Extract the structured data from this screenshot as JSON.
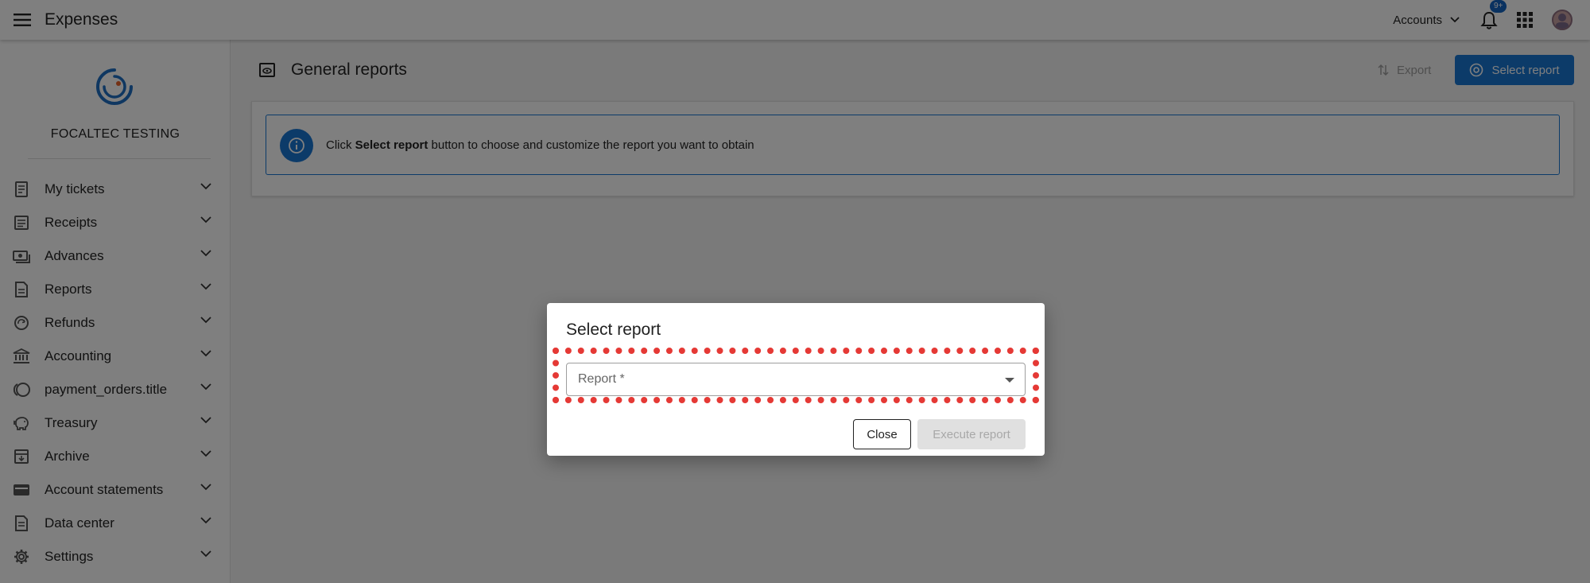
{
  "app": {
    "title": "Expenses"
  },
  "topbar": {
    "accounts_label": "Accounts",
    "notification_badge": "9+"
  },
  "sidebar": {
    "org_name": "FOCALTEC TESTING",
    "items": [
      {
        "label": "My tickets",
        "icon": "ticket-icon"
      },
      {
        "label": "Receipts",
        "icon": "receipt-icon"
      },
      {
        "label": "Advances",
        "icon": "money-icon"
      },
      {
        "label": "Reports",
        "icon": "report-icon"
      },
      {
        "label": "Refunds",
        "icon": "refund-icon"
      },
      {
        "label": "Accounting",
        "icon": "bank-icon"
      },
      {
        "label": "payment_orders.title",
        "icon": "payment-icon"
      },
      {
        "label": "Treasury",
        "icon": "piggy-bank-icon"
      },
      {
        "label": "Archive",
        "icon": "archive-icon"
      },
      {
        "label": "Account statements",
        "icon": "wallet-icon"
      },
      {
        "label": "Data center",
        "icon": "data-icon"
      },
      {
        "label": "Settings",
        "icon": "gear-icon"
      }
    ]
  },
  "page": {
    "title": "General reports",
    "export_label": "Export",
    "select_report_label": "Select report",
    "info_prefix": "Click ",
    "info_bold": "Select report",
    "info_suffix": " button to choose and customize the report you want to obtain"
  },
  "dialog": {
    "title": "Select report",
    "report_placeholder": "Report *",
    "close_label": "Close",
    "execute_label": "Execute report"
  },
  "colors": {
    "primary": "#1976d2",
    "highlight": "#e53935"
  }
}
